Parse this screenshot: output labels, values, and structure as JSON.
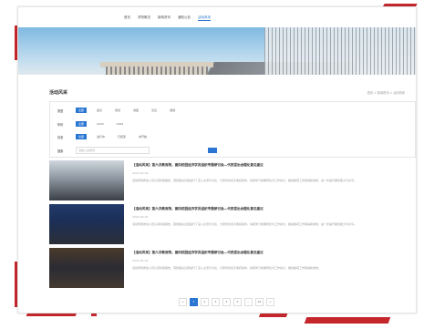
{
  "nav": {
    "items": [
      {
        "label": "首页"
      },
      {
        "label": "学院概况"
      },
      {
        "label": "新闻资讯"
      },
      {
        "label": "通知公告"
      },
      {
        "label": "活动风采"
      }
    ],
    "active_index": 4
  },
  "banner": {
    "label": "building-banner-image"
  },
  "section": {
    "title": "活动风采",
    "breadcrumb": "首页 > 新闻资讯 > 活动风采"
  },
  "filters": {
    "rows": [
      {
        "label": "类型",
        "options": [
          "全部",
          "会议",
          "培训",
          "讲座",
          "论坛",
          "其他"
        ],
        "active": 0
      },
      {
        "label": "年份",
        "options": [
          "全部",
          "2023",
          "2022"
        ],
        "active": 0
      },
      {
        "label": "状态",
        "options": [
          "全部",
          "进行中",
          "已结束",
          "未开始"
        ],
        "active": 0
      }
    ],
    "search_label": "搜索",
    "search_placeholder": "请输入关键词"
  },
  "items": [
    {
      "title": "【活动风采】第六次教育院，面向校园经济学员组织专题研讨会—代表提出合理化意见建议",
      "date": "2023-04-26",
      "desc": "活动现场参会人员认真听取报告，围绕相关议题进行了深入交流与讨论，大家纷纷表示收获颇丰，将把学习成果转化为工作动力，推动各项工作取得新成效，进一步提升服务能力与水平。"
    },
    {
      "title": "【活动风采】第六次教育院，面向校园经济学员组织专题研讨会—代表提出合理化意见建议",
      "date": "2023-04-26",
      "desc": "活动现场参会人员认真听取报告，围绕相关议题进行了深入交流与讨论，大家纷纷表示收获颇丰，将把学习成果转化为工作动力，推动各项工作取得新成效，进一步提升服务能力与水平。"
    },
    {
      "title": "【活动风采】第六次教育院，面向校园经济学员组织专题研讨会—代表提出合理化意见建议",
      "date": "2023-04-26",
      "desc": "活动现场参会人员认真听取报告，围绕相关议题进行了深入交流与讨论，大家纷纷表示收获颇丰，将把学习成果转化为工作动力，推动各项工作取得新成效。"
    }
  ],
  "pager": {
    "pages": [
      "<",
      "1",
      "2",
      "3",
      "4",
      "5",
      "...",
      "10",
      ">"
    ],
    "active": 1
  },
  "colors": {
    "accent": "#2a76d2",
    "frame": "#c4262b"
  }
}
